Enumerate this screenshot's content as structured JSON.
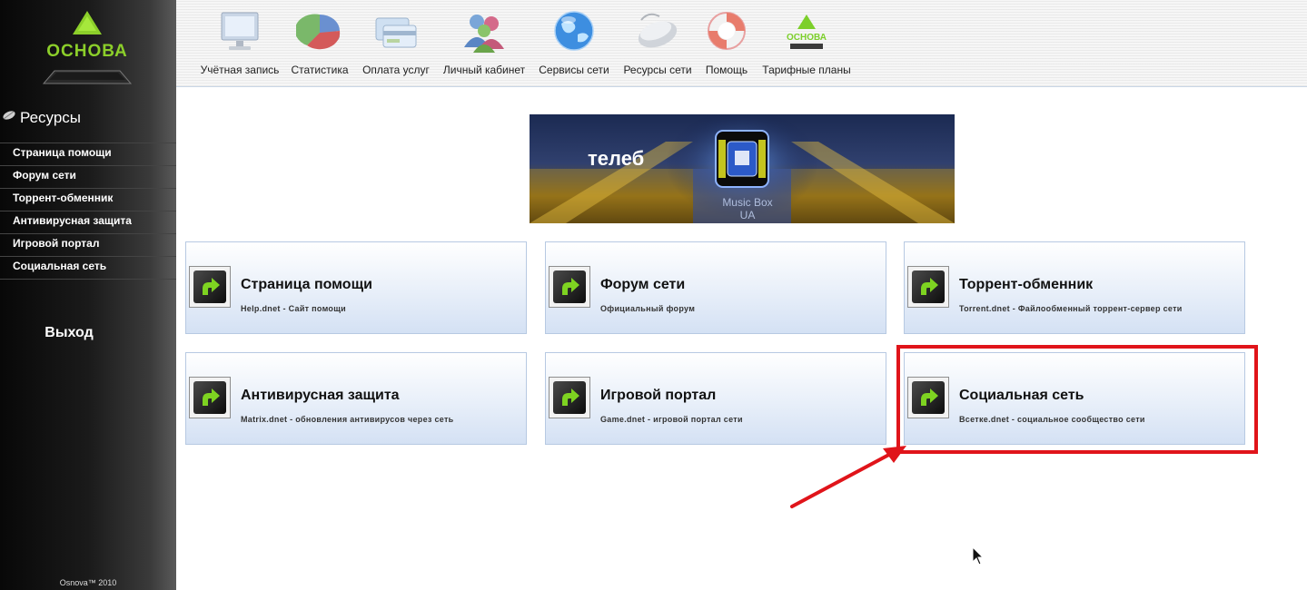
{
  "brand": {
    "logo_text": "ОСНОВА",
    "copyright": "Osnova™ 2010"
  },
  "top_nav": [
    {
      "label": "Учётная запись",
      "icon": "monitor-icon"
    },
    {
      "label": "Статистика",
      "icon": "pie-chart-icon"
    },
    {
      "label": "Оплата услуг",
      "icon": "credit-cards-icon"
    },
    {
      "label": "Личный кабинет",
      "icon": "users-icon"
    },
    {
      "label": "Сервисы сети",
      "icon": "globe-icon"
    },
    {
      "label": "Ресурсы сети",
      "icon": "mouse-icon"
    },
    {
      "label": "Помощь",
      "icon": "lifebuoy-icon"
    },
    {
      "label": "Тарифные планы",
      "icon": "osnova-logo-icon"
    }
  ],
  "sidebar": {
    "section_title": "Ресурсы",
    "items": [
      {
        "label": "Страница помощи"
      },
      {
        "label": "Форум сети"
      },
      {
        "label": "Торрент-обменник"
      },
      {
        "label": "Антивирусная защита"
      },
      {
        "label": "Игровой портал"
      },
      {
        "label": "Социальная сеть"
      }
    ],
    "logout": "Выход"
  },
  "banner": {
    "text": "телеб",
    "subtext_line1": "Music Box",
    "subtext_line2": "UA"
  },
  "cards": [
    {
      "title": "Страница помощи",
      "desc": "Help.dnet - Сайт помощи"
    },
    {
      "title": "Форум сети",
      "desc": "Официальный форум"
    },
    {
      "title": "Торрент-обменник",
      "desc": "Torrent.dnet - Файлообменный торрент-сервер сети"
    },
    {
      "title": "Антивирусная защита",
      "desc": "Matrix.dnet - обновления антивирусов через сеть"
    },
    {
      "title": "Игровой портал",
      "desc": "Game.dnet - игровой портал сети"
    },
    {
      "title": "Социальная сеть",
      "desc": "Всетке.dnet - социальное сообщество сети"
    }
  ],
  "colors": {
    "card_border": "#b7c9e2",
    "highlight": "#e0141a",
    "accent_green": "#7ed321"
  }
}
